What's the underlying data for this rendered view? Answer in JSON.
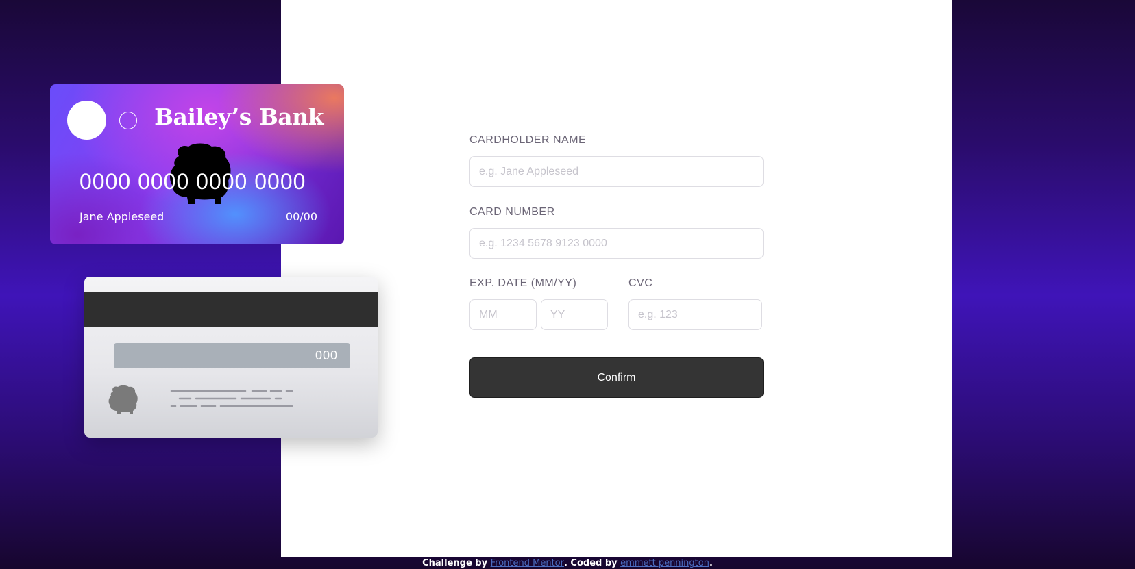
{
  "card_front": {
    "bank_name": "Bailey’s Bank",
    "number": "0000 0000 0000 0000",
    "holder": "Jane Appleseed",
    "expiry": "00/00"
  },
  "card_back": {
    "cvc": "000"
  },
  "form": {
    "cardholder_label": "CARDHOLDER NAME",
    "cardholder_placeholder": "e.g. Jane Appleseed",
    "number_label": "CARD NUMBER",
    "number_placeholder": "e.g. 1234 5678 9123 0000",
    "exp_label": "EXP. DATE (MM/YY)",
    "mm_placeholder": "MM",
    "yy_placeholder": "YY",
    "cvc_label": "CVC",
    "cvc_placeholder": "e.g. 123",
    "confirm_label": "Confirm"
  },
  "footer": {
    "prefix": "Challenge by ",
    "link1": "Frontend Mentor",
    "middle": ". Coded by ",
    "link2": "emmett pennington",
    "suffix": "."
  },
  "colors": {
    "background_accent": "#3f14b8",
    "button": "#343434",
    "link": "#4b6cc0"
  },
  "icons": [
    "bulldog-icon",
    "card-logo-circle-icon"
  ]
}
